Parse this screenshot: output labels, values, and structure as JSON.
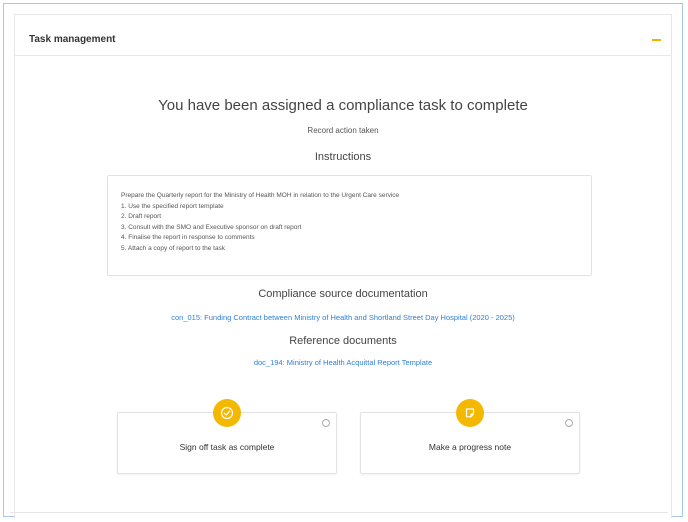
{
  "panel": {
    "title": "Task management",
    "collapse_icon": "minus-icon"
  },
  "headline": "You have been assigned a compliance task to complete",
  "subline": "Record action taken",
  "instructions": {
    "title": "Instructions",
    "lines": [
      "Prepare the Quarterly report for the Ministry of Health  MOH in relation to the Urgent Care service",
      "1. Use the specified report template",
      "2. Draft report",
      "3. Consult with the SMO and Executive sponsor on draft report",
      "4. Finalise the report in response to comments",
      "5. Attach a copy of report to the task"
    ]
  },
  "compliance": {
    "title": "Compliance source documentation",
    "link": "con_015: Funding Contract between Ministry of Health and Shortland Street Day Hospital (2020 - 2025)"
  },
  "reference": {
    "title": "Reference documents",
    "link": "doc_194: Ministry of Health Acquittal Report Template"
  },
  "actions": [
    {
      "label": "Sign off task as complete",
      "icon": "check-circle-icon"
    },
    {
      "label": "Make a progress note",
      "icon": "note-icon"
    }
  ],
  "colors": {
    "accent": "#f5b800",
    "link": "#2f7fd8",
    "frame_border": "#a9c6e6"
  }
}
